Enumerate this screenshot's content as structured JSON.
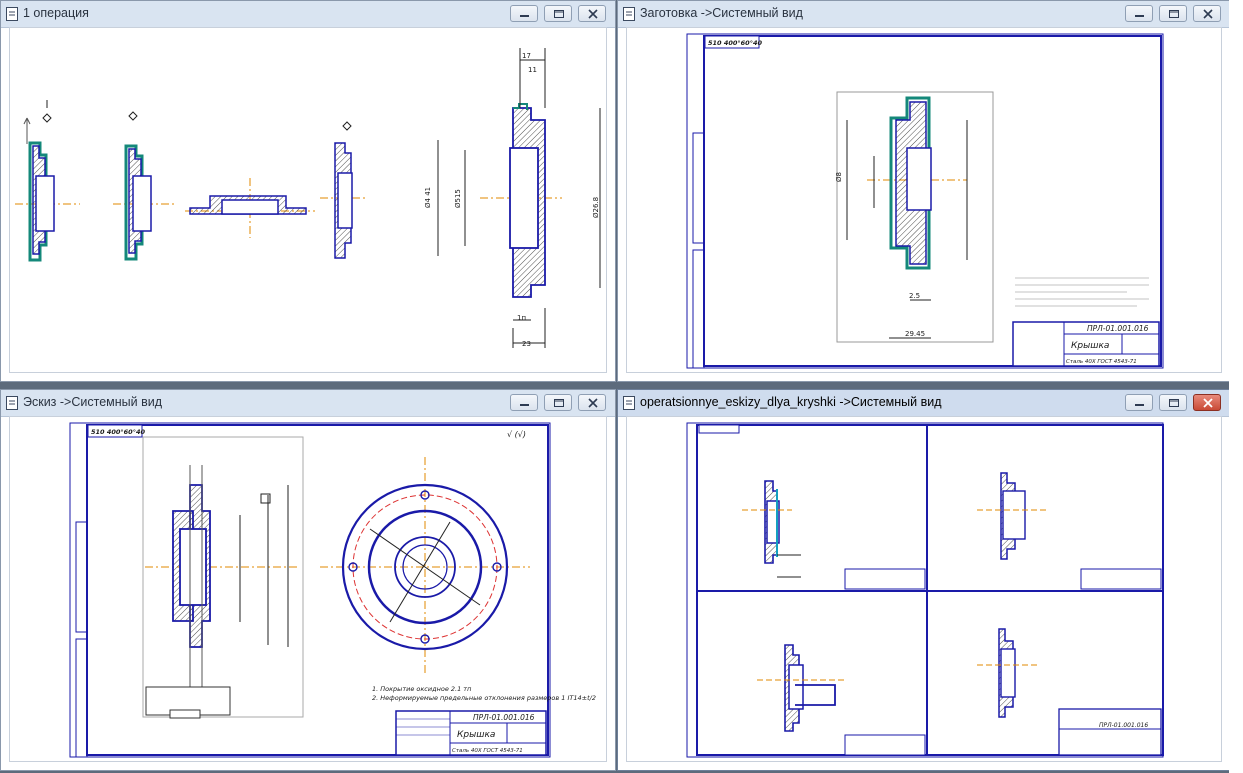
{
  "windows": {
    "op1": {
      "title": "1 операция"
    },
    "blank": {
      "title": "Заготовка ->Системный вид",
      "code": "ПРЛ-01.001.016",
      "part": "Крышка",
      "material": "Сталь 40Х ГОСТ 4543-71",
      "corner_mark": "510 400°60°40"
    },
    "sketch": {
      "title": "Эскиз ->Системный вид",
      "code": "ПРЛ-01.001.016",
      "part": "Крышка",
      "material": "Сталь 40Х ГОСТ 4543-71",
      "corner_mark": "510 400°60°40",
      "notes": [
        "1. Покрытие оксидное 2.1 тп",
        "2. Неформируемые предельные отклонения размеров 1 IT14±t/2"
      ]
    },
    "opsk": {
      "title": "operatsionnye_eskizy_dlya_kryshki ->Системный вид",
      "code": "ПРЛ-01.001.016"
    }
  },
  "window_controls": {
    "minimize": "minimize",
    "maximize": "maximize",
    "close": "close"
  }
}
